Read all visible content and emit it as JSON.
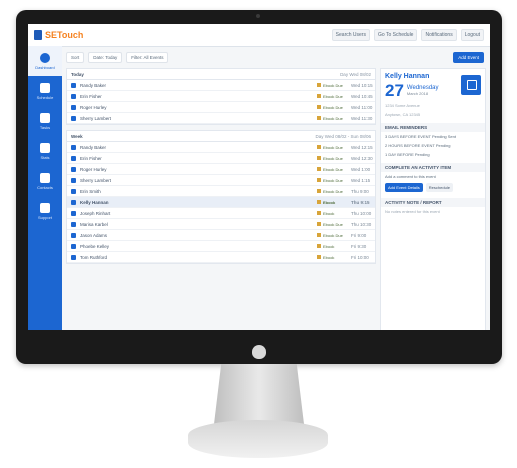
{
  "app": {
    "logo_text": "SETouch"
  },
  "topbar": {
    "buttons": [
      "Search Users",
      "Go To Schedule",
      "Notifications",
      "Logout"
    ]
  },
  "nav": {
    "items": [
      {
        "label": "Dashboard",
        "icon": "dashboard-icon"
      },
      {
        "label": "Schedule",
        "icon": "calendar-icon"
      },
      {
        "label": "Tasks",
        "icon": "wrench-icon"
      },
      {
        "label": "Stats",
        "icon": "chart-icon"
      },
      {
        "label": "Contacts",
        "icon": "contacts-icon"
      },
      {
        "label": "Support",
        "icon": "support-icon"
      }
    ]
  },
  "filters": {
    "chips": [
      "Sort",
      "Date: Today",
      "Filter: All Events"
    ],
    "new_button": "Add Event"
  },
  "main": {
    "sections": [
      {
        "title": "Today",
        "meta": "Day Wed 08/02",
        "rows": [
          {
            "name": "Randy Baker",
            "tag": "Ebook Due",
            "time": "Wed 10:15"
          },
          {
            "name": "Erin Fisher",
            "tag": "Ebook Due",
            "time": "Wed 10:45"
          },
          {
            "name": "Roger Hurley",
            "tag": "Ebook Due",
            "time": "Wed 11:00"
          },
          {
            "name": "Sherry Lambert",
            "tag": "Ebook Due",
            "time": "Wed 11:30"
          }
        ]
      },
      {
        "title": "Week",
        "meta": "Day Wed 08/02 - Sun 08/06",
        "rows": [
          {
            "name": "Randy Baker",
            "tag": "Ebook Due",
            "time": "Wed 12:15",
            "selected": false
          },
          {
            "name": "Erin Fisher",
            "tag": "Ebook Due",
            "time": "Wed 12:30",
            "selected": false
          },
          {
            "name": "Roger Hurley",
            "tag": "Ebook Due",
            "time": "Wed 1:00",
            "selected": false
          },
          {
            "name": "Sherry Lambert",
            "tag": "Ebook Due",
            "time": "Wed 1:15",
            "selected": false
          },
          {
            "name": "Erin Smith",
            "tag": "Ebook Due",
            "time": "Thu 9:00",
            "selected": false
          },
          {
            "name": "Kelly Hannan",
            "tag": "Ebook",
            "time": "Thu 9:15",
            "selected": true
          },
          {
            "name": "Joseph Rinhart",
            "tag": "Ebook",
            "time": "Thu 10:00",
            "selected": false
          },
          {
            "name": "Marisa Karbel",
            "tag": "Ebook Due",
            "time": "Thu 10:30",
            "selected": false
          },
          {
            "name": "Jason Adams",
            "tag": "Ebook Due",
            "time": "Fri 9:00",
            "selected": false
          },
          {
            "name": "Phoebe Kelley",
            "tag": "Ebook",
            "time": "Fri 9:30",
            "selected": false
          },
          {
            "name": "Tom Ruthford",
            "tag": "Ebook",
            "time": "Fri 10:00",
            "selected": false
          }
        ]
      }
    ]
  },
  "right": {
    "person_name": "Kelly Hannan",
    "day_num": "27",
    "day_name": "Wednesday",
    "day_sub": "March 2018",
    "info_line1": "1234 Some Avenue",
    "info_line2": "Anytown, CA 12345",
    "section1_title": "EMAIL REMINDERS",
    "section1_lines": [
      "3 DAYS BEFORE EVENT Pending Sent",
      "2 HOURS BEFORE EVENT Pending",
      "1 DAY BEFORE Pending"
    ],
    "section2_title": "COMPLETE AN ACTIVITY ITEM",
    "section2_line": "Add a comment to this event",
    "btn_primary": "Add Event Details",
    "btn_secondary": "Reschedule",
    "section3_title": "ACTIVITY NOTE / REPORT",
    "section3_line": "No notes entered for this event"
  }
}
